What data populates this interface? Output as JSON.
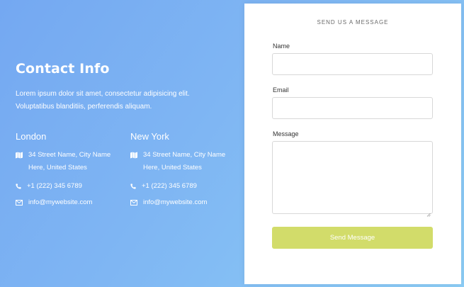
{
  "contact": {
    "title": "Contact Info",
    "description": "Lorem ipsum dolor sit amet, consectetur adipisicing elit. Voluptatibus blanditiis, perferendis aliquam.",
    "offices": [
      {
        "name": "London",
        "address_line1": "34 Street Name, City Name",
        "address_line2": "Here, United States",
        "phone": "+1 (222) 345 6789",
        "email": "info@mywebsite.com"
      },
      {
        "name": "New York",
        "address_line1": "34 Street Name, City Name",
        "address_line2": "Here, United States",
        "phone": "+1 (222) 345 6789",
        "email": "info@mywebsite.com"
      }
    ],
    "icons": {
      "address": "map-icon",
      "phone": "phone-icon",
      "email": "envelope-icon"
    }
  },
  "form": {
    "heading": "SEND US A MESSAGE",
    "name_label": "Name",
    "name_value": "",
    "email_label": "Email",
    "email_value": "",
    "message_label": "Message",
    "message_value": "",
    "submit_label": "Send Message"
  },
  "colors": {
    "gradient_start": "#74a8f2",
    "gradient_end": "#8ccdf6",
    "button": "#d2dc6a",
    "card": "#ffffff"
  }
}
